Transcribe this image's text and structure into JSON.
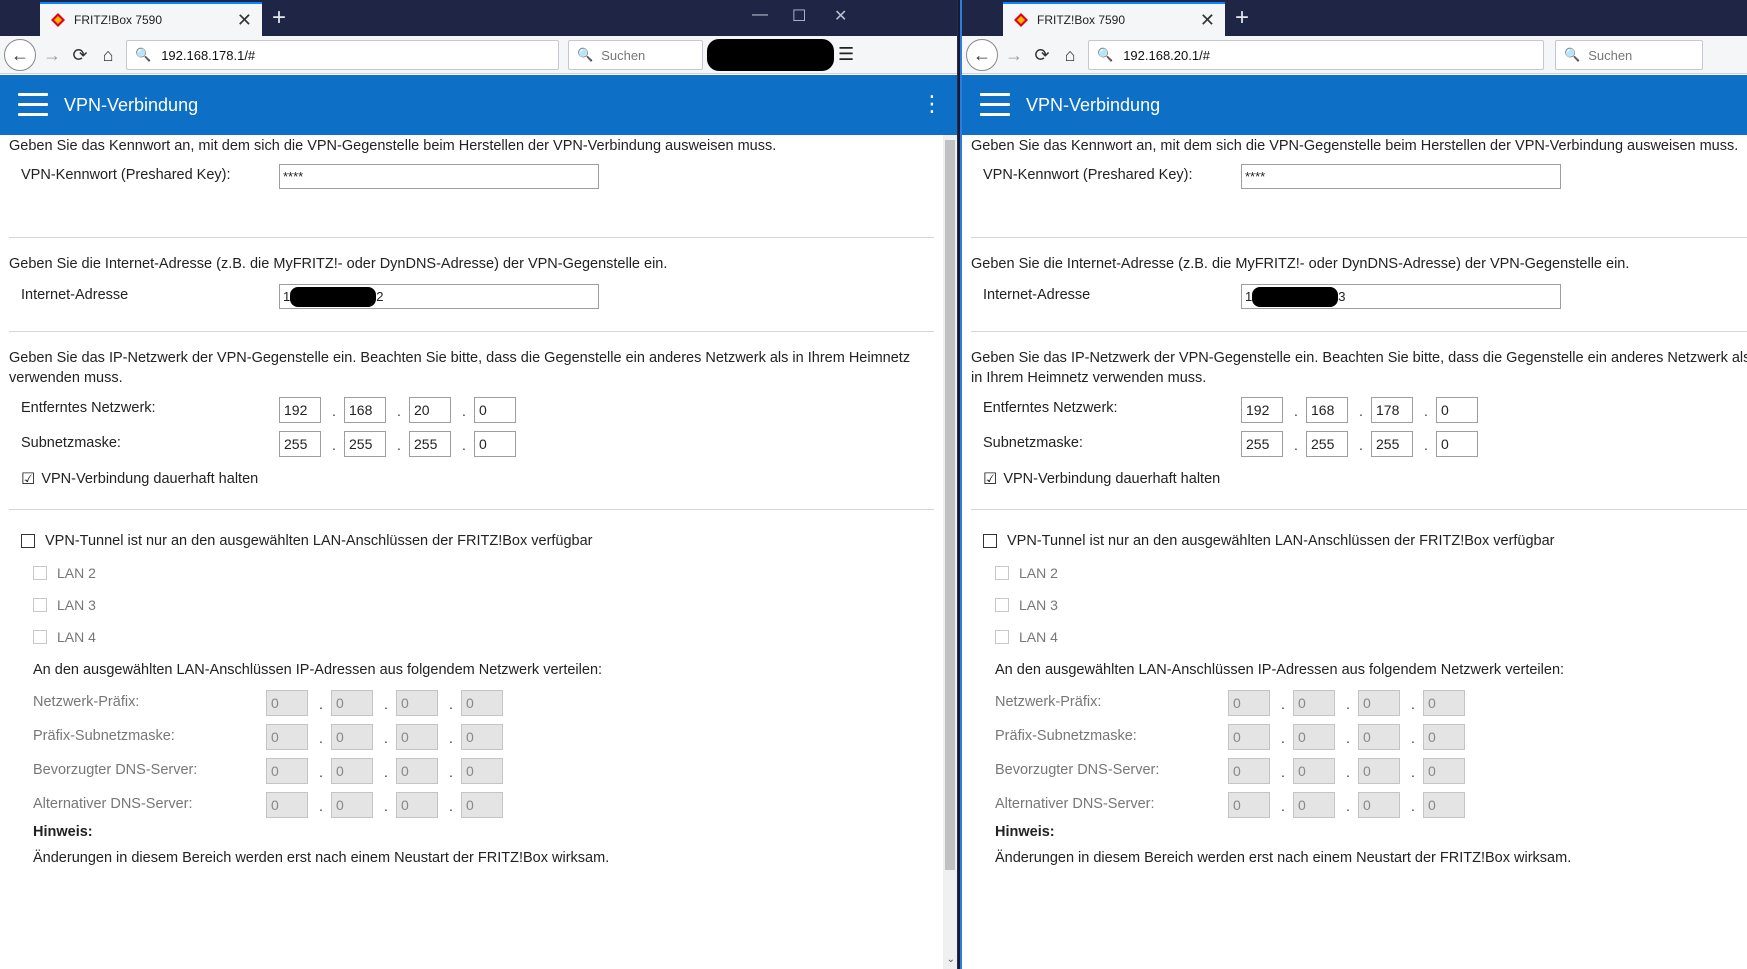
{
  "left": {
    "tab_title": "FRITZ!Box 7590",
    "url": "192.168.178.1/#",
    "search_placeholder": "Suchen",
    "app_title": "VPN-Verbindung",
    "psk_desc": "Geben Sie das Kennwort an, mit dem sich die VPN-Gegenstelle beim Herstellen der VPN-Verbindung ausweisen muss.",
    "psk_label": "VPN-Kennwort (Preshared Key):",
    "psk_value": "****",
    "inet_desc": "Geben Sie die Internet-Adresse (z.B. die MyFRITZ!- oder DynDNS-Adresse) der VPN-Gegenstelle ein.",
    "inet_label": "Internet-Adresse",
    "inet_prefix": "1",
    "inet_suffix": "2",
    "net_desc": "Geben Sie das IP-Netzwerk der VPN-Gegenstelle ein. Beachten Sie bitte, dass die Gegenstelle ein anderes Netzwerk als in Ihrem Heimnetz verwenden muss.",
    "remote_label": "Entferntes Netzwerk:",
    "remote": [
      "192",
      "168",
      "20",
      "0"
    ],
    "mask_label": "Subnetzmaske:",
    "mask": [
      "255",
      "255",
      "255",
      "0"
    ],
    "keep_label": "VPN-Verbindung dauerhaft halten",
    "keep_checked": "☑",
    "tunnel_label": "VPN-Tunnel ist nur an den ausgewählten LAN-Anschlüssen der FRITZ!Box verfügbar",
    "lan": [
      "LAN 2",
      "LAN 3",
      "LAN 4"
    ],
    "dist_desc": "An den ausgewählten LAN-Anschlüssen IP-Adressen aus folgendem Netzwerk verteilen:",
    "sub_rows": [
      {
        "label": "Netzwerk-Präfix:",
        "v": [
          "0",
          "0",
          "0",
          "0"
        ]
      },
      {
        "label": "Präfix-Subnetzmaske:",
        "v": [
          "0",
          "0",
          "0",
          "0"
        ]
      },
      {
        "label": "Bevorzugter DNS-Server:",
        "v": [
          "0",
          "0",
          "0",
          "0"
        ]
      },
      {
        "label": "Alternativer DNS-Server:",
        "v": [
          "0",
          "0",
          "0",
          "0"
        ]
      }
    ],
    "hint_head": "Hinweis:",
    "hint_text": "Änderungen in diesem Bereich werden erst nach einem Neustart der FRITZ!Box wirksam."
  },
  "right": {
    "tab_title": "FRITZ!Box 7590",
    "url": "192.168.20.1/#",
    "search_placeholder": "Suchen",
    "app_title": "VPN-Verbindung",
    "psk_desc": "Geben Sie das Kennwort an, mit dem sich die VPN-Gegenstelle beim Herstellen der VPN-Verbindung ausweisen muss.",
    "psk_label": "VPN-Kennwort (Preshared Key):",
    "psk_value": "****",
    "inet_desc": "Geben Sie die Internet-Adresse (z.B. die MyFRITZ!- oder DynDNS-Adresse) der VPN-Gegenstelle ein.",
    "inet_label": "Internet-Adresse",
    "inet_prefix": "1",
    "inet_suffix": "3",
    "net_desc": "Geben Sie das IP-Netzwerk der VPN-Gegenstelle ein. Beachten Sie bitte, dass die Gegenstelle ein anderes Netzwerk als in Ihrem Heimnetz verwenden muss.",
    "remote_label": "Entferntes Netzwerk:",
    "remote": [
      "192",
      "168",
      "178",
      "0"
    ],
    "mask_label": "Subnetzmaske:",
    "mask": [
      "255",
      "255",
      "255",
      "0"
    ],
    "keep_label": "VPN-Verbindung dauerhaft halten",
    "keep_checked": "☑",
    "tunnel_label": "VPN-Tunnel ist nur an den ausgewählten LAN-Anschlüssen der FRITZ!Box verfügbar",
    "lan": [
      "LAN 2",
      "LAN 3",
      "LAN 4"
    ],
    "dist_desc": "An den ausgewählten LAN-Anschlüssen IP-Adressen aus folgendem Netzwerk verteilen:",
    "sub_rows": [
      {
        "label": "Netzwerk-Präfix:",
        "v": [
          "0",
          "0",
          "0",
          "0"
        ]
      },
      {
        "label": "Präfix-Subnetzmaske:",
        "v": [
          "0",
          "0",
          "0",
          "0"
        ]
      },
      {
        "label": "Bevorzugter DNS-Server:",
        "v": [
          "0",
          "0",
          "0",
          "0"
        ]
      },
      {
        "label": "Alternativer DNS-Server:",
        "v": [
          "0",
          "0",
          "0",
          "0"
        ]
      }
    ],
    "hint_head": "Hinweis:",
    "hint_text": "Änderungen in diesem Bereich werden erst nach einem Neustart der FRITZ!Box wirksam."
  },
  "icons": {
    "favicon": "fritzbox-icon",
    "back": "←",
    "forward": "→",
    "reload": "⟳",
    "home": "⌂",
    "search": "🔍",
    "minimize": "—",
    "maximize": "☐",
    "close": "✕",
    "kebab": "⋮",
    "menu": "☰",
    "newtab": "+",
    "tabclose": "✕",
    "scroll_down": "⌄"
  },
  "colors": {
    "appbar": "#0d6fc6",
    "tabbar": "#1f2545",
    "active_border": "#2a7de1"
  }
}
